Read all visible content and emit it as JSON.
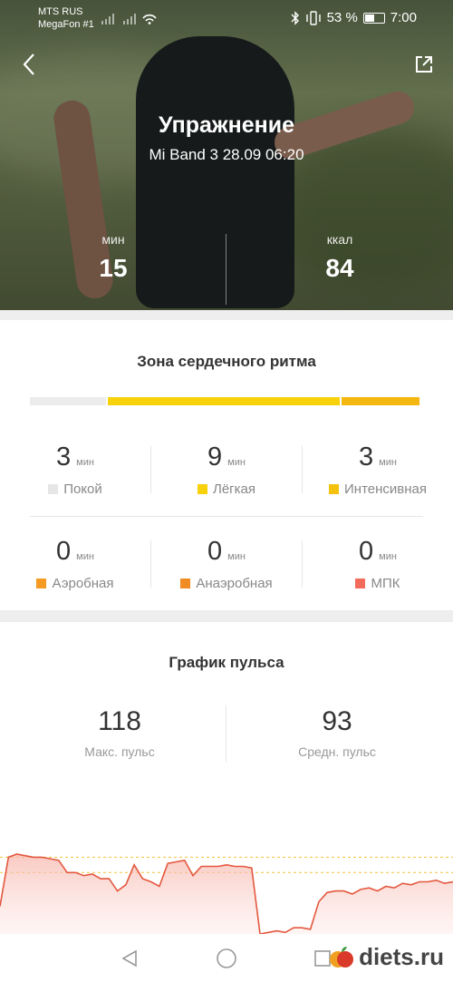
{
  "status_bar": {
    "carrier_1": "MTS RUS",
    "carrier_2": "MegaFon #1",
    "battery": "53 %",
    "time": "7:00"
  },
  "header": {
    "title": "Упражнение",
    "subtitle": "Mi Band 3 28.09 06:20",
    "stats": [
      {
        "label": "мин",
        "value": "15"
      },
      {
        "label": "ккал",
        "value": "84"
      }
    ]
  },
  "heart_zone": {
    "title": "Зона сердечного ритма",
    "unit": "мин",
    "bar_fractions": [
      3,
      9,
      3
    ],
    "bar_colors": [
      "#ececec",
      "#f7d10a",
      "#f4b70f"
    ],
    "zones": [
      {
        "value": "3",
        "name": "Покой",
        "color": "#e6e6e6"
      },
      {
        "value": "9",
        "name": "Лёгкая",
        "color": "#f7d10a"
      },
      {
        "value": "3",
        "name": "Интенсивная",
        "color": "#f4c20d"
      },
      {
        "value": "0",
        "name": "Аэробная",
        "color": "#f59a23"
      },
      {
        "value": "0",
        "name": "Анаэробная",
        "color": "#f08c22"
      },
      {
        "value": "0",
        "name": "МПК",
        "color": "#f26b5b"
      }
    ]
  },
  "pulse": {
    "title": "График пульса",
    "max_value": "118",
    "max_label": "Макс. пульс",
    "avg_value": "93",
    "avg_label": "Средн. пульс"
  },
  "chart_data": {
    "type": "area",
    "ylim": [
      60,
      125
    ],
    "reference_lines": [
      110,
      100
    ],
    "values": [
      78,
      110,
      112,
      111,
      110,
      110,
      109,
      108,
      100,
      100,
      98,
      99,
      96,
      96,
      88,
      92,
      105,
      96,
      94,
      91,
      106,
      107,
      108,
      98,
      104,
      104,
      104,
      105,
      104,
      104,
      103,
      60,
      61,
      62,
      61,
      64,
      64,
      63,
      81,
      87,
      88,
      88,
      86,
      89,
      90,
      88,
      91,
      90,
      93,
      92,
      94,
      94,
      95,
      93,
      94
    ]
  },
  "watermark": "diets.ru"
}
